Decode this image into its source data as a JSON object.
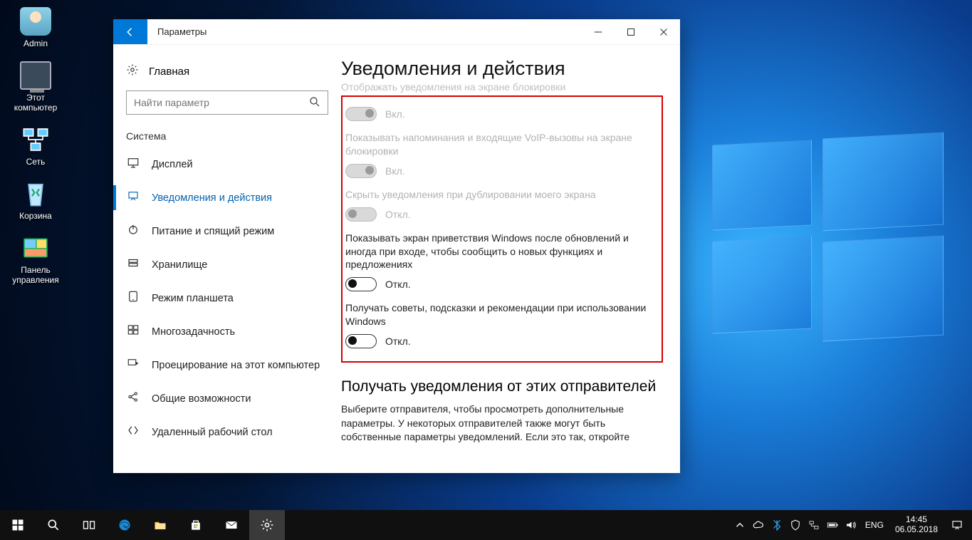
{
  "desktop": {
    "icons": [
      {
        "label": "Admin"
      },
      {
        "label": "Этот компьютер"
      },
      {
        "label": "Сеть"
      },
      {
        "label": "Корзина"
      },
      {
        "label": "Панель управления"
      }
    ]
  },
  "window": {
    "title": "Параметры",
    "home_label": "Главная",
    "search_placeholder": "Найти параметр",
    "section_label": "Система",
    "nav": [
      {
        "label": "Дисплей"
      },
      {
        "label": "Уведомления и действия"
      },
      {
        "label": "Питание и спящий режим"
      },
      {
        "label": "Хранилище"
      },
      {
        "label": "Режим планшета"
      },
      {
        "label": "Многозадачность"
      },
      {
        "label": "Проецирование на этот компьютер"
      },
      {
        "label": "Общие возможности"
      },
      {
        "label": "Удаленный рабочий стол"
      }
    ]
  },
  "content": {
    "heading": "Уведомления и действия",
    "cut_label": "Отображать уведомления на экране блокировки",
    "options": [
      {
        "label": "",
        "state": "Вкл.",
        "disabled": true,
        "on": true
      },
      {
        "label": "Показывать напоминания и входящие VoIP-вызовы на экране блокировки",
        "state": "Вкл.",
        "disabled": true,
        "on": true
      },
      {
        "label": "Скрыть уведомления при дублировании моего экрана",
        "state": "Откл.",
        "disabled": true,
        "on": false
      },
      {
        "label": "Показывать экран приветствия Windows после обновлений и иногда при входе, чтобы сообщить о новых функциях и предложениях",
        "state": "Откл.",
        "disabled": false,
        "on": false
      },
      {
        "label": "Получать советы, подсказки и рекомендации при использовании Windows",
        "state": "Откл.",
        "disabled": false,
        "on": false
      }
    ],
    "sub_heading": "Получать уведомления от этих отправителей",
    "sub_text": "Выберите отправителя, чтобы просмотреть дополнительные параметры. У некоторых отправителей также могут быть собственные параметры уведомлений. Если это так, откройте"
  },
  "taskbar": {
    "lang": "ENG",
    "time": "14:45",
    "date": "06.05.2018"
  }
}
